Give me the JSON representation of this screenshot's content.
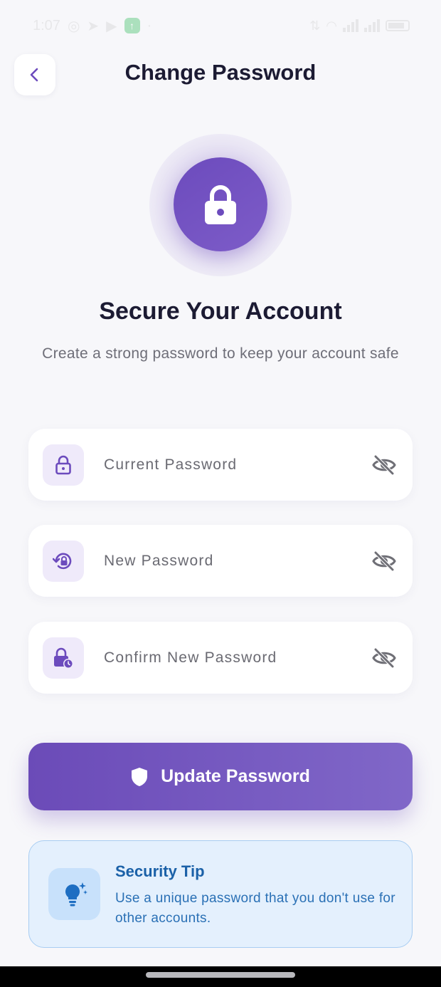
{
  "status_bar": {
    "time": "1:07"
  },
  "header": {
    "title": "Change Password"
  },
  "hero": {
    "heading": "Secure Your Account",
    "subheading": "Create a strong password to keep your account safe"
  },
  "fields": [
    {
      "placeholder": "Current Password",
      "icon": "lock-icon"
    },
    {
      "placeholder": "New Password",
      "icon": "lock-reset-icon"
    },
    {
      "placeholder": "Confirm New Password",
      "icon": "lock-clock-icon"
    }
  ],
  "primary_button": {
    "label": "Update Password",
    "icon": "shield-icon"
  },
  "tip": {
    "title": "Security Tip",
    "text": "Use a unique password that you don't use for other accounts.",
    "icon": "lightbulb-icon"
  },
  "colors": {
    "accent": "#6c4bbd",
    "accent_light": "#efeafa",
    "tip_background": "#e4f0fd",
    "tip_text": "#1b61a8",
    "background": "#f7f7fa"
  }
}
